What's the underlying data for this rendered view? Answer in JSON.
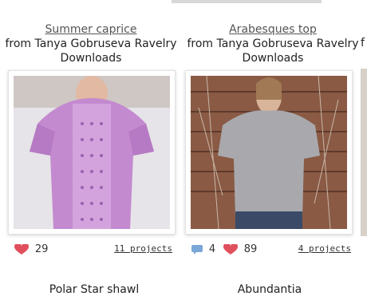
{
  "patterns": [
    {
      "title": "Summer caprice",
      "byline": "from Tanya Gobruseva Ravelry Downloads",
      "favorites": "29",
      "projects": "11 projects"
    },
    {
      "title": "Arabesques top",
      "byline": "from Tanya Gobruseva Ravelry Downloads",
      "comments": "4",
      "favorites": "89",
      "projects": "4 projects"
    }
  ],
  "next_row": [
    "Polar Star shawl",
    "Abundantia"
  ],
  "edge_byline": "f",
  "colors": {
    "heart": "#e0505c",
    "bubble": "#7aa6d8"
  }
}
